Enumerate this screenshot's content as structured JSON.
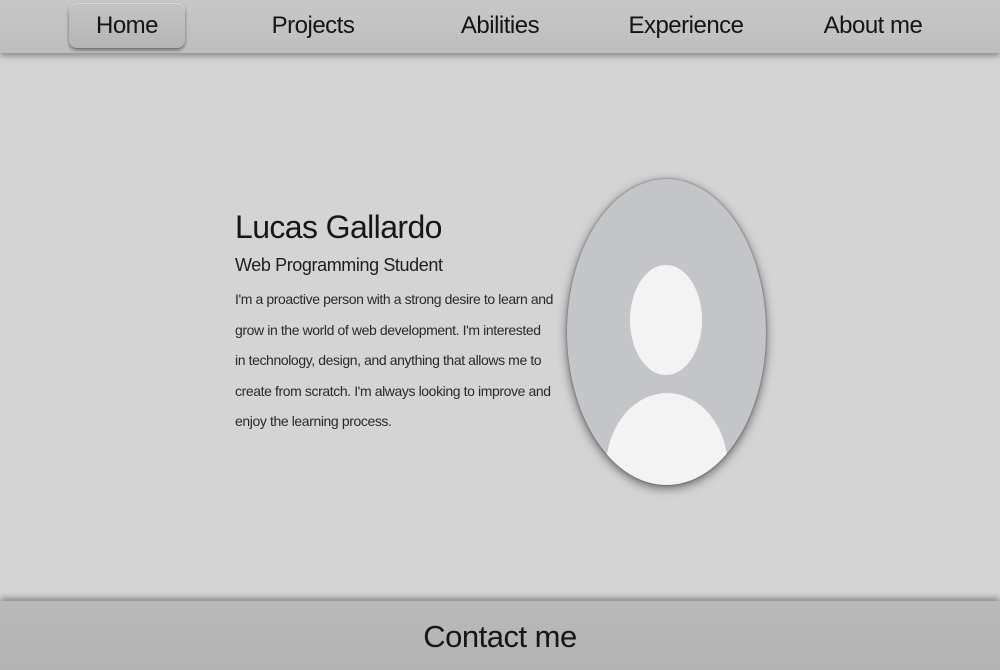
{
  "nav": {
    "items": [
      {
        "label": "Home",
        "active": true
      },
      {
        "label": "Projects",
        "active": false
      },
      {
        "label": "Abilities",
        "active": false
      },
      {
        "label": "Experience",
        "active": false
      },
      {
        "label": "About me",
        "active": false
      }
    ]
  },
  "hero": {
    "name": "Lucas Gallardo",
    "role": "Web Programming Student",
    "bio": "I'm a proactive person with a strong desire to learn and grow in the world of web development. I'm interested in technology, design, and anything that allows me to create from scratch. I'm always looking to improve and enjoy the learning process."
  },
  "avatar": {
    "icon": "user-silhouette-icon"
  },
  "footer": {
    "contact_label": "Contact me"
  }
}
